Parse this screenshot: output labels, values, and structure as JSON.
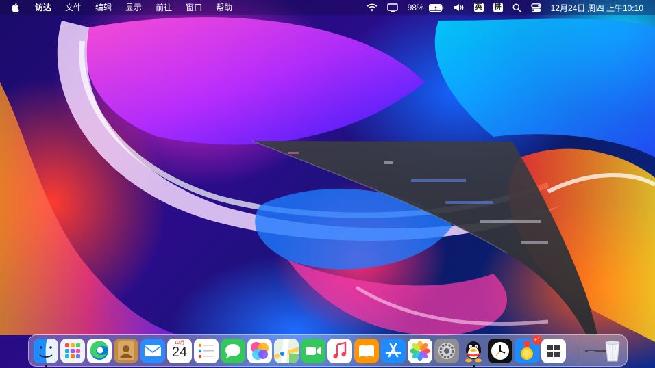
{
  "menubar": {
    "app_name": "访达",
    "items": [
      "文件",
      "编辑",
      "显示",
      "前往",
      "窗口",
      "帮助"
    ],
    "battery_percent": "98%",
    "input_method_en": "英",
    "input_method_pinyin": "拼",
    "datetime": "12月24日 周四 上午10:10"
  },
  "dock": {
    "apps": [
      {
        "name": "访达",
        "icon": "finder-icon",
        "running": true
      },
      {
        "name": "启动台",
        "icon": "launchpad-icon",
        "running": false
      },
      {
        "name": "Microsoft Edge",
        "icon": "edge-icon",
        "running": false
      },
      {
        "name": "通讯录",
        "icon": "contacts-icon",
        "running": false
      },
      {
        "name": "邮件",
        "icon": "mail-icon",
        "running": false
      },
      {
        "name": "日历",
        "icon": "calendar-icon",
        "running": false
      },
      {
        "name": "提醒事项",
        "icon": "reminders-icon",
        "running": false
      },
      {
        "name": "信息",
        "icon": "messages-icon",
        "running": false
      },
      {
        "name": "Game Center",
        "icon": "game-center-icon",
        "running": false
      },
      {
        "name": "地图",
        "icon": "maps-icon",
        "running": false
      },
      {
        "name": "FaceTime",
        "icon": "facetime-icon",
        "running": false
      },
      {
        "name": "音乐",
        "icon": "music-icon",
        "running": false
      },
      {
        "name": "图书",
        "icon": "books-icon",
        "running": false
      },
      {
        "name": "App Store",
        "icon": "app-store-icon",
        "running": false
      },
      {
        "name": "照片",
        "icon": "photos-icon",
        "running": false
      },
      {
        "name": "系统偏好设置",
        "icon": "system-preferences-icon",
        "running": false
      },
      {
        "name": "QQ",
        "icon": "qq-icon",
        "running": true
      },
      {
        "name": "时钟",
        "icon": "clock-icon",
        "running": false
      },
      {
        "name": "奖章",
        "icon": "medal-icon",
        "running": false
      },
      {
        "name": "Windows",
        "icon": "windows-icon",
        "running": false
      }
    ],
    "calendar_month": "12月",
    "calendar_day": "24",
    "medal_badge": "+1",
    "minimized_item": "minimized-window-thumbnail",
    "trash": "trash-icon"
  },
  "colors": {
    "menubar_text": "#ffffff",
    "dock_bg": "rgba(235,235,245,0.35)",
    "wallpaper_primary": "#2a0c8a",
    "wallpaper_accent_pink": "#ff2ad8",
    "wallpaper_accent_orange": "#ff5a1a",
    "wallpaper_accent_cyan": "#0fd3ff"
  }
}
